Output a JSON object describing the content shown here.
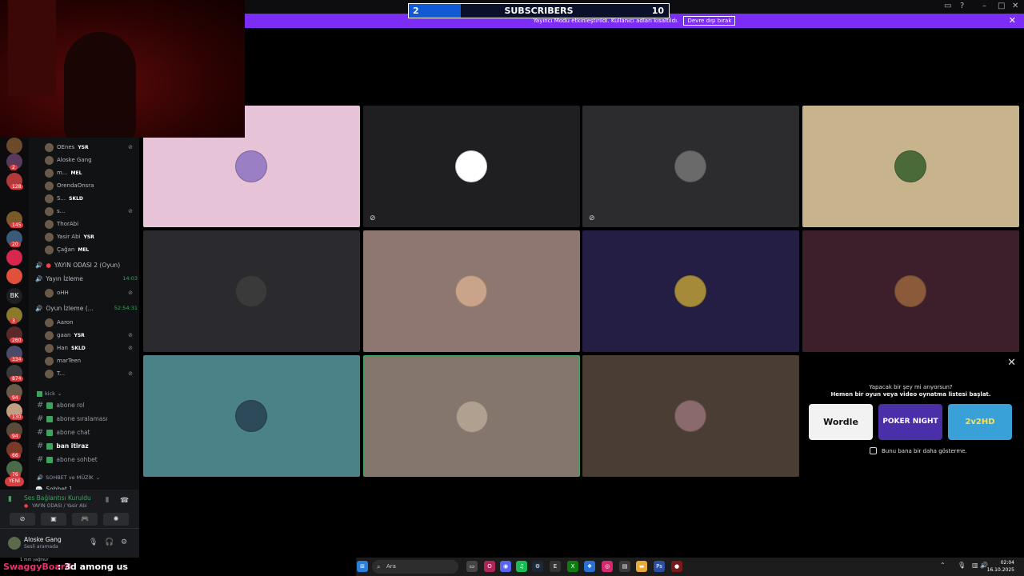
{
  "overlay": {
    "sub_left": "2",
    "sub_label": "SUBSCRIBERS",
    "sub_right": "10",
    "sub_progress": 0.2
  },
  "banner": {
    "text": "Yayıncı Modu etkinleştirildi. Kullanıcı adları kısaltıldı.",
    "button": "Devre dışı bırak",
    "close": "✕"
  },
  "servers": [
    {
      "label": "",
      "badge": ""
    },
    {
      "label": "",
      "badge": "2"
    },
    {
      "label": "",
      "badge": "128"
    },
    {
      "label": "",
      "badge": "145"
    },
    {
      "label": "",
      "badge": "20"
    },
    {
      "label": "",
      "badge": ""
    },
    {
      "label": "",
      "badge": ""
    },
    {
      "label": "BK",
      "badge": ""
    },
    {
      "label": "",
      "badge": "3"
    },
    {
      "label": "",
      "badge": "260"
    },
    {
      "label": "",
      "badge": "334"
    },
    {
      "label": "",
      "badge": "874"
    },
    {
      "label": "",
      "badge": "94"
    },
    {
      "label": "",
      "badge": "130"
    },
    {
      "label": "",
      "badge": "94"
    },
    {
      "label": "",
      "badge": "66"
    },
    {
      "label": "",
      "badge": "76"
    },
    {
      "label": "YENİ",
      "badge": ""
    }
  ],
  "room1_users": [
    {
      "name": "OEnes",
      "tag": "YSR",
      "muted": true
    },
    {
      "name": "Aloske Gang",
      "tag": "",
      "muted": false
    },
    {
      "name": "m...",
      "tag": "MEL",
      "muted": false
    },
    {
      "name": "OrendaOnsra",
      "tag": "",
      "muted": false
    },
    {
      "name": "S...",
      "tag": "SKLD",
      "muted": false
    },
    {
      "name": "s...",
      "tag": "",
      "muted": true
    },
    {
      "name": "ThorAbi",
      "tag": "",
      "muted": false
    },
    {
      "name": "Yasir Abi",
      "tag": "YSR",
      "muted": false
    },
    {
      "name": "Çağan",
      "tag": "MEL",
      "muted": false
    }
  ],
  "voice_channels": {
    "room2": "YAYIN ODASI 2 (Oyun)",
    "watch": "Yayın İzleme",
    "watch_time": "14:03",
    "watch_user": "oHH",
    "game": "Oyun İzleme (...",
    "game_time": "52:54:31"
  },
  "game_users": [
    {
      "name": "Aaron",
      "tag": "",
      "muted": false
    },
    {
      "name": "gaan",
      "tag": "YSR",
      "muted": true
    },
    {
      "name": "Han",
      "tag": "SKLD",
      "muted": true
    },
    {
      "name": "marTeen",
      "tag": "",
      "muted": false
    },
    {
      "name": "T...",
      "tag": "",
      "muted": true
    }
  ],
  "kick_category": "kick",
  "text_channels": [
    "abone rol",
    "abone sıralaması",
    "abone chat",
    "ban itiraz",
    "abone sohbet"
  ],
  "music_category": "SOHBET ve MÜZİK",
  "music_channel": "Sohbet 1",
  "voice_panel": {
    "title": "Ses Bağlantısı Kuruldu",
    "subtitle": "YAYIN ODASI / Yasir Abi"
  },
  "user_panel": {
    "name": "Aloske Gang",
    "status": "Sesli aramada"
  },
  "tiles": [
    {
      "bg": "#e6c3d6",
      "avatar": "#9a7fc4",
      "muted": false,
      "highlight": false
    },
    {
      "bg": "#1f1f21",
      "avatar": "#ffffff",
      "muted": true,
      "highlight": false
    },
    {
      "bg": "#2c2c2e",
      "avatar": "#6a6a6a",
      "muted": true,
      "highlight": false
    },
    {
      "bg": "#c8b48c",
      "avatar": "#4b6a3a",
      "muted": false,
      "highlight": false
    },
    {
      "bg": "#2b2b2f",
      "avatar": "#3a3a3a",
      "muted": false,
      "highlight": false
    },
    {
      "bg": "#8e7770",
      "avatar": "#c9a48a",
      "muted": false,
      "highlight": false
    },
    {
      "bg": "#241e44",
      "avatar": "#a58a3a",
      "muted": false,
      "highlight": false
    },
    {
      "bg": "#3d1f2c",
      "avatar": "#8a5a3a",
      "muted": false,
      "highlight": false
    },
    {
      "bg": "#4b8288",
      "avatar": "#2c4a5a",
      "muted": false,
      "highlight": false
    },
    {
      "bg": "#84766c",
      "avatar": "#b0a090",
      "muted": false,
      "highlight": true
    },
    {
      "bg": "#4a3e34",
      "avatar": "#8a6a6a",
      "muted": false,
      "highlight": false
    }
  ],
  "activity": {
    "line1": "Yapacak bir şey mi arıyorsun?",
    "line2": "Hemen bir oyun veya video oynatma listesi başlat.",
    "games": [
      "Wordle",
      "POKER NIGHT",
      "2v2HD"
    ],
    "checkbox": "Bunu bana bir daha gösterme."
  },
  "ticker": {
    "name": "SwaggyBoard",
    "message": ": 3d among us",
    "rain": "1 mm yağmur"
  },
  "taskbar": {
    "search": "Ara",
    "time": "02:04",
    "date": "16.10.2025"
  }
}
